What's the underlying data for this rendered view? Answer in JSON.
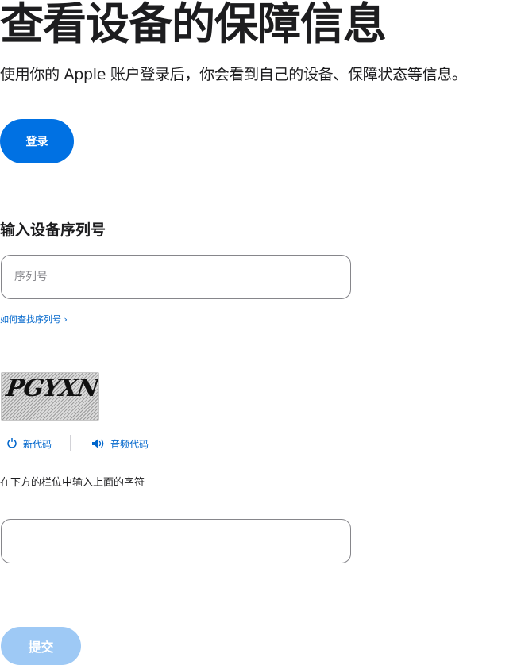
{
  "page": {
    "title": "查看设备的保障信息",
    "subtitle": "使用你的 Apple 账户登录后，你会看到自己的设备、保障状态等信息。"
  },
  "signin": {
    "label": "登录"
  },
  "serial": {
    "heading": "输入设备序列号",
    "placeholder": "序列号",
    "value": "",
    "help_link": "如何查找序列号 ›"
  },
  "captcha": {
    "image_text": "PGYXN",
    "new_code": "新代码",
    "audio_code": "音频代码",
    "instructions": "在下方的栏位中输入上面的字符",
    "value": "",
    "placeholder": ""
  },
  "submit": {
    "label": "提交",
    "enabled": false
  },
  "colors": {
    "accent": "#0071e3",
    "link": "#0066cc",
    "disabled_button": "#9ec9f5",
    "text": "#1d1d1f",
    "border": "#86868b"
  },
  "icons": {
    "new_code": "refresh-icon",
    "audio_code": "speaker-icon"
  }
}
